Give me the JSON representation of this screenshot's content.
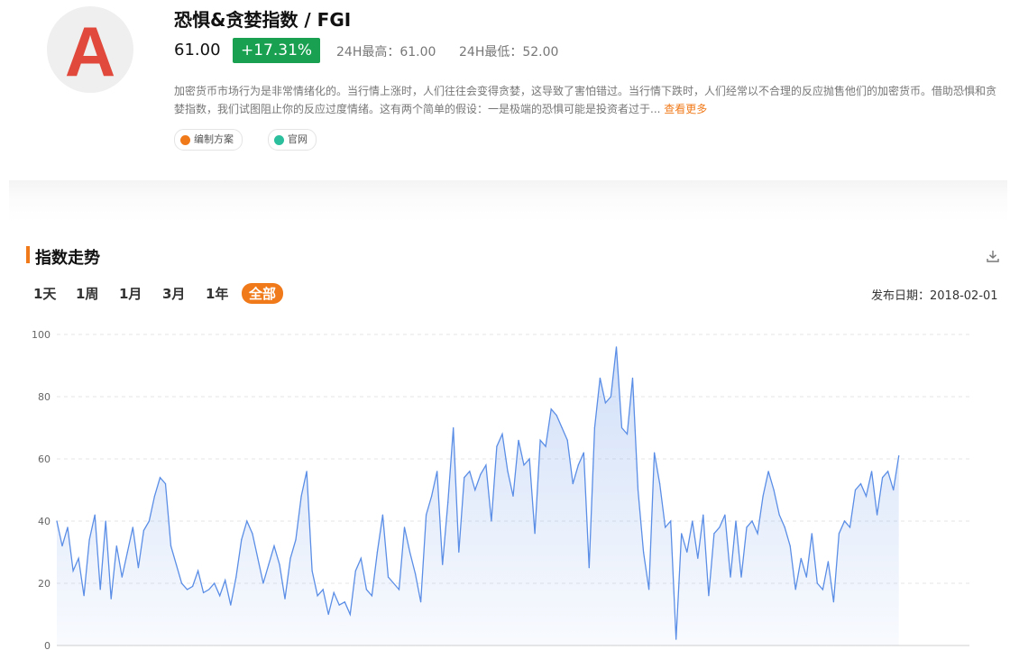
{
  "header": {
    "logo_letter": "A",
    "title": "恐惧&贪婪指数 / FGI",
    "price": "61.00",
    "change": "+17.31%",
    "high_24h": "24H最高：61.00",
    "low_24h": "24H最低：52.00",
    "description": "加密货币市场行为是非常情绪化的。当行情上涨时，人们往往会变得贪婪，这导致了害怕错过。当行情下跌时，人们经常以不合理的反应抛售他们的加密货币。借助恐惧和贪婪指数，我们试图阻止你的反应过度情绪。这有两个简单的假设：一是极端的恐惧可能是投资者过于...",
    "more_label": "查看更多",
    "tags": [
      "编制方案",
      "官网"
    ]
  },
  "section": {
    "title": "指数走势",
    "ranges": [
      "1天",
      "1周",
      "1月",
      "3月",
      "1年",
      "全部"
    ],
    "active_range": "全部",
    "publish_date": "发布日期：2018-02-01"
  },
  "colors": {
    "accent": "#f07a1a",
    "up": "#19a151",
    "line": "#5b8ee6",
    "logo": "#e0493b"
  },
  "chart_data": {
    "type": "area",
    "ylim": [
      0,
      100
    ],
    "yticks": [
      0,
      20,
      40,
      60,
      80,
      100
    ],
    "grid": true,
    "x_index": [
      0,
      6,
      12,
      18,
      24,
      30,
      36,
      42,
      48,
      54,
      60,
      66,
      72,
      78,
      84,
      90,
      96,
      102,
      108,
      114,
      120,
      126,
      132,
      138,
      144,
      150,
      156,
      162,
      168,
      174,
      180,
      186,
      192,
      198,
      204,
      210,
      216,
      222,
      228,
      234,
      240,
      246,
      252,
      258,
      264,
      270,
      276,
      282,
      288,
      294,
      300,
      306,
      312,
      318,
      324,
      330,
      336,
      342,
      348,
      354,
      360,
      366,
      372,
      378,
      384,
      390,
      396,
      402,
      408,
      414,
      420,
      426,
      432,
      438,
      444,
      450,
      456,
      462,
      468,
      474,
      480,
      486,
      492,
      498,
      504,
      510,
      516,
      522,
      528,
      534,
      540,
      546,
      552,
      558,
      564,
      570,
      576,
      582,
      588,
      594,
      600,
      606,
      612,
      618,
      624,
      630,
      636,
      642,
      648,
      654,
      660,
      666,
      672,
      678,
      684,
      690,
      696,
      702,
      708,
      714,
      720,
      726,
      732,
      738,
      744,
      750,
      756,
      762,
      768,
      774,
      780,
      786,
      792,
      798,
      804,
      810,
      816,
      822,
      828,
      834,
      840,
      846,
      852,
      858,
      864,
      870,
      876,
      882,
      888,
      894,
      900,
      906,
      912,
      918,
      924,
      930,
      936,
      942,
      948,
      954,
      960,
      966,
      972,
      978,
      984,
      990,
      996,
      1002,
      1008
    ],
    "values": [
      40,
      32,
      38,
      24,
      28,
      16,
      34,
      42,
      18,
      40,
      15,
      32,
      22,
      30,
      38,
      25,
      37,
      40,
      48,
      54,
      52,
      32,
      26,
      20,
      18,
      19,
      24,
      17,
      18,
      20,
      16,
      21,
      13,
      22,
      34,
      40,
      36,
      28,
      20,
      26,
      32,
      26,
      15,
      28,
      34,
      48,
      56,
      24,
      16,
      18,
      10,
      17,
      13,
      14,
      10,
      24,
      28,
      18,
      16,
      30,
      42,
      22,
      20,
      18,
      38,
      30,
      23,
      14,
      42,
      48,
      56,
      26,
      46,
      70,
      30,
      54,
      56,
      50,
      55,
      58,
      40,
      64,
      68,
      56,
      48,
      66,
      58,
      60,
      36,
      66,
      64,
      76,
      74,
      70,
      66,
      52,
      58,
      62,
      25,
      70,
      86,
      78,
      80,
      96,
      70,
      68,
      86,
      50,
      30,
      18,
      62,
      52,
      38,
      40,
      2,
      36,
      30,
      40,
      28,
      42,
      16,
      36,
      38,
      42,
      22,
      40,
      22,
      38,
      40,
      36,
      48,
      56,
      50,
      42,
      38,
      32,
      18,
      28,
      22,
      36,
      20,
      18,
      27,
      14,
      36,
      40,
      38,
      50,
      52,
      48,
      56,
      42,
      54,
      56,
      50,
      61
    ]
  }
}
